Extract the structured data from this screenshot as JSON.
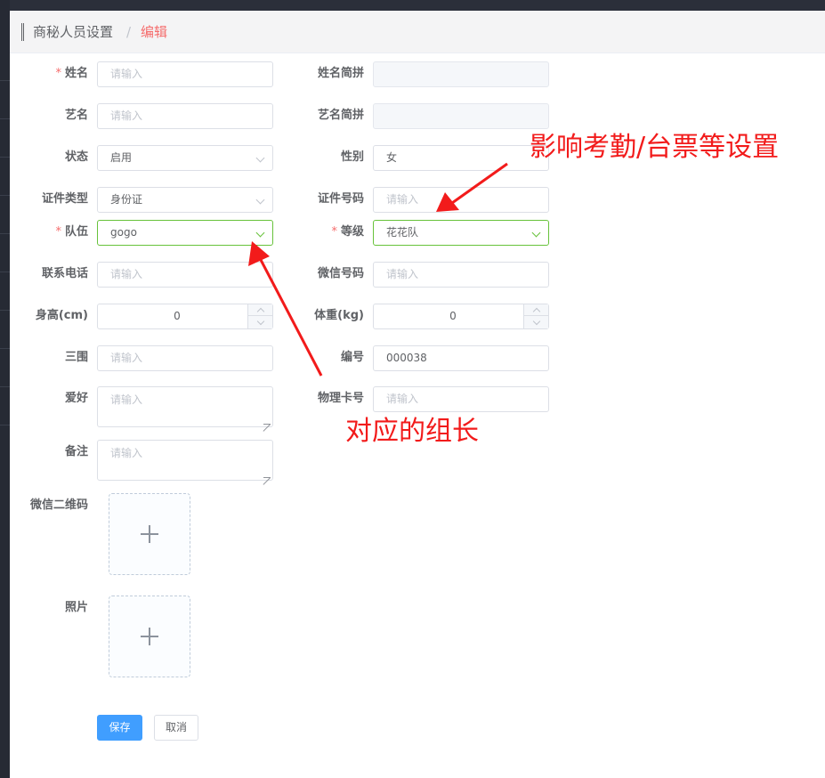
{
  "breadcrumb": {
    "parent": "商秘人员设置",
    "separator": "/",
    "current": "编辑"
  },
  "form": {
    "name": {
      "label": "姓名",
      "required": "*",
      "placeholder": "请输入"
    },
    "name_pinyin": {
      "label": "姓名简拼"
    },
    "stage_name": {
      "label": "艺名",
      "placeholder": "请输入"
    },
    "stage_name_pinyin": {
      "label": "艺名简拼"
    },
    "status": {
      "label": "状态",
      "value": "启用"
    },
    "gender": {
      "label": "性别",
      "value": "女"
    },
    "id_type": {
      "label": "证件类型",
      "value": "身份证"
    },
    "id_number": {
      "label": "证件号码",
      "placeholder": "请输入"
    },
    "team": {
      "label": "队伍",
      "required": "*",
      "value": "gogo"
    },
    "level": {
      "label": "等级",
      "required": "*",
      "value": "花花队"
    },
    "phone": {
      "label": "联系电话",
      "placeholder": "请输入"
    },
    "wechat": {
      "label": "微信号码",
      "placeholder": "请输入"
    },
    "height": {
      "label": "身高(cm)",
      "value": "0"
    },
    "weight": {
      "label": "体重(kg)",
      "value": "0"
    },
    "measurements": {
      "label": "三围",
      "placeholder": "请输入"
    },
    "code": {
      "label": "编号",
      "value": "000038"
    },
    "hobby": {
      "label": "爱好",
      "placeholder": "请输入"
    },
    "card_no": {
      "label": "物理卡号",
      "placeholder": "请输入"
    },
    "remark": {
      "label": "备注",
      "placeholder": "请输入"
    },
    "wechat_qr": {
      "label": "微信二维码"
    },
    "photo": {
      "label": "照片"
    }
  },
  "actions": {
    "save": "保存",
    "cancel": "取消"
  },
  "annotations": {
    "level_note": "影响考勤/台票等设置",
    "team_note": "对应的组长"
  },
  "colors": {
    "primary": "#409eff",
    "required": "#f56c6c",
    "focus": "#67c23a",
    "annotation": "#f21b1b"
  }
}
